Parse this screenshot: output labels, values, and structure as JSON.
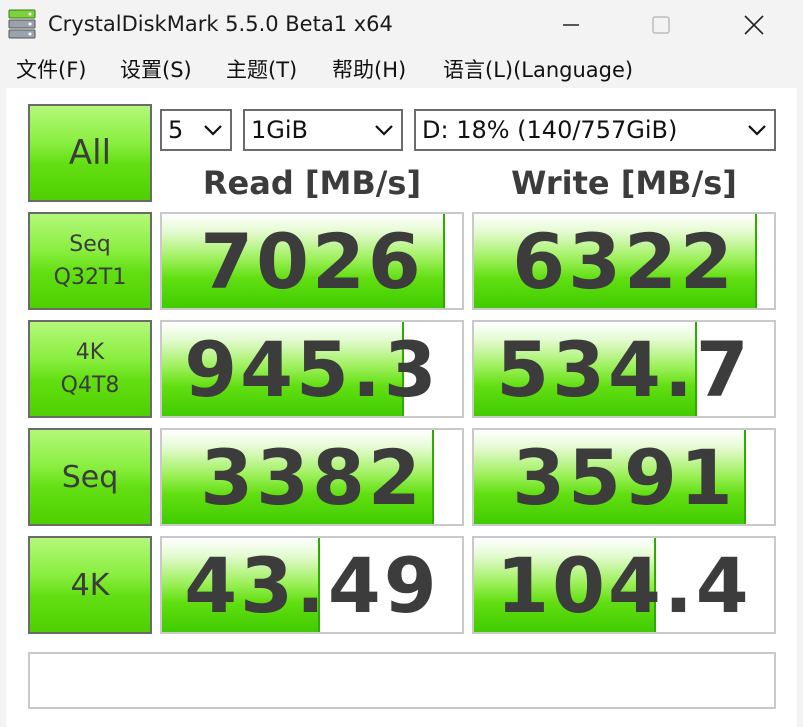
{
  "window": {
    "title": "CrystalDiskMark 5.5.0 Beta1 x64",
    "icon": "crystaldiskmark-app-icon"
  },
  "menu": [
    {
      "label": "文件(F)"
    },
    {
      "label": "设置(S)"
    },
    {
      "label": "主题(T)"
    },
    {
      "label": "帮助(H)"
    },
    {
      "label": "语言(L)(Language)"
    }
  ],
  "controls": {
    "all_label": "All",
    "count_value": "5",
    "size_value": "1GiB",
    "drive_value": "D: 18% (140/757GiB)"
  },
  "headers": {
    "read": "Read [MB/s]",
    "write": "Write [MB/s]"
  },
  "tests": [
    {
      "label": "Seq\nQ32T1",
      "read": "7026",
      "write": "6322",
      "read_level": 0.935,
      "write_level": 0.935
    },
    {
      "label": "4K\nQ4T8",
      "read": "945.3",
      "write": "534.7",
      "read_level": 0.8,
      "write_level": 0.735
    },
    {
      "label": "Seq",
      "read": "3382",
      "write": "3591",
      "read_level": 0.9,
      "write_level": 0.9
    },
    {
      "label": "4K",
      "read": "43.49",
      "write": "104.4",
      "read_level": 0.52,
      "write_level": 0.6
    }
  ],
  "status_text": "",
  "colors": {
    "accent_green": "#62df12",
    "text": "#3c3c3c"
  }
}
